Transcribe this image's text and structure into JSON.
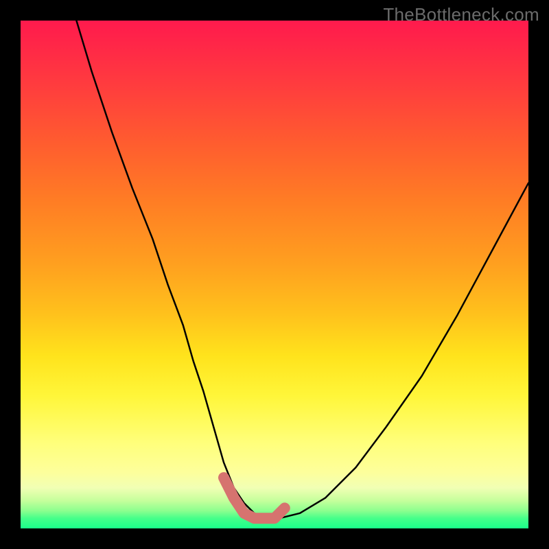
{
  "watermark": "TheBottleneck.com",
  "chart_data": {
    "type": "line",
    "title": "",
    "xlabel": "",
    "ylabel": "",
    "xlim": [
      0,
      100
    ],
    "ylim": [
      0,
      100
    ],
    "grid": false,
    "legend": false,
    "series": [
      {
        "name": "bottleneck-curve",
        "x": [
          11,
          14,
          18,
          22,
          26,
          29,
          32,
          34,
          36,
          38,
          40,
          42,
          44,
          46,
          48,
          51,
          55,
          60,
          66,
          72,
          79,
          86,
          93,
          100
        ],
        "values": [
          100,
          90,
          78,
          67,
          57,
          48,
          40,
          33,
          27,
          20,
          13,
          8,
          5,
          3,
          2,
          2,
          3,
          6,
          12,
          20,
          30,
          42,
          55,
          68
        ]
      },
      {
        "name": "bottom-highlight",
        "x": [
          40,
          42,
          44,
          46,
          48,
          50,
          52
        ],
        "values": [
          10,
          6,
          3,
          2,
          2,
          2,
          4
        ]
      }
    ],
    "gradient_stops": [
      {
        "pos": 0,
        "color": "#ff1a4d"
      },
      {
        "pos": 0.5,
        "color": "#ffb020"
      },
      {
        "pos": 0.75,
        "color": "#fff63a"
      },
      {
        "pos": 0.93,
        "color": "#e8ffb0"
      },
      {
        "pos": 1.0,
        "color": "#1aff8a"
      }
    ]
  }
}
